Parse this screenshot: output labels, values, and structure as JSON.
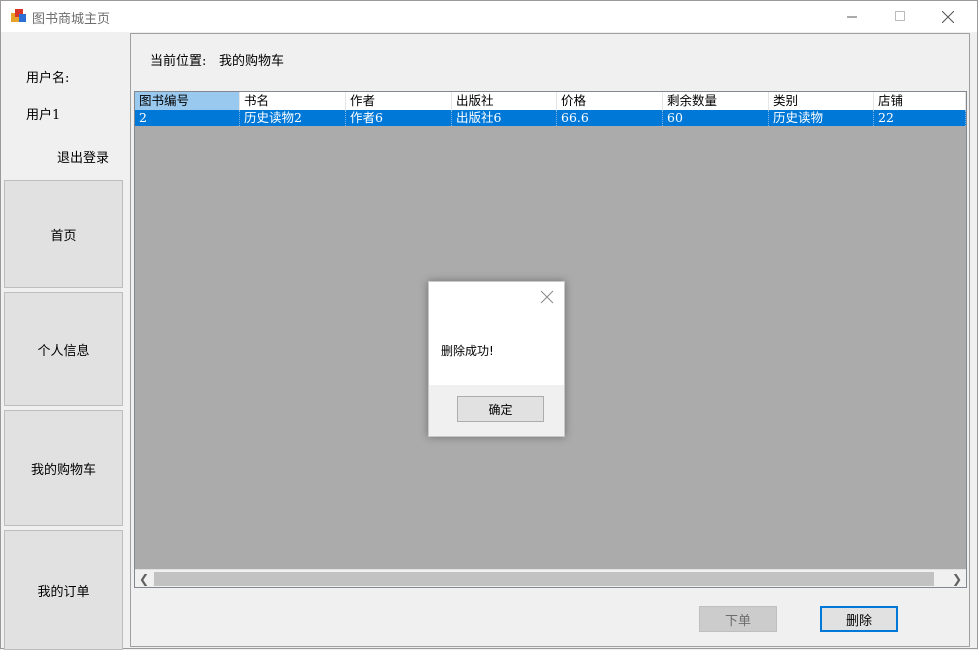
{
  "window": {
    "title": "图书商城主页"
  },
  "sidebar": {
    "user_label": "用户名:",
    "username": "用户1",
    "logout": "退出登录",
    "nav": [
      {
        "label": "首页"
      },
      {
        "label": "个人信息"
      },
      {
        "label": "我的购物车"
      },
      {
        "label": "我的订单"
      }
    ]
  },
  "main": {
    "location_label": "当前位置:",
    "location_value": "我的购物车"
  },
  "table": {
    "columns": [
      "图书编号",
      "书名",
      "作者",
      "出版社",
      "价格",
      "剩余数量",
      "类别",
      "店铺"
    ],
    "rows": [
      [
        "2",
        "历史读物2",
        "作者6",
        "出版社6",
        "66.6",
        "60",
        "历史读物",
        "22"
      ]
    ]
  },
  "actions": {
    "order": "下单",
    "delete": "删除"
  },
  "dialog": {
    "message": "删除成功!",
    "ok": "确定"
  },
  "colors": {
    "selection": "#0078d7",
    "grid_bg": "#ababab",
    "header_selected": "#99c9ef"
  }
}
